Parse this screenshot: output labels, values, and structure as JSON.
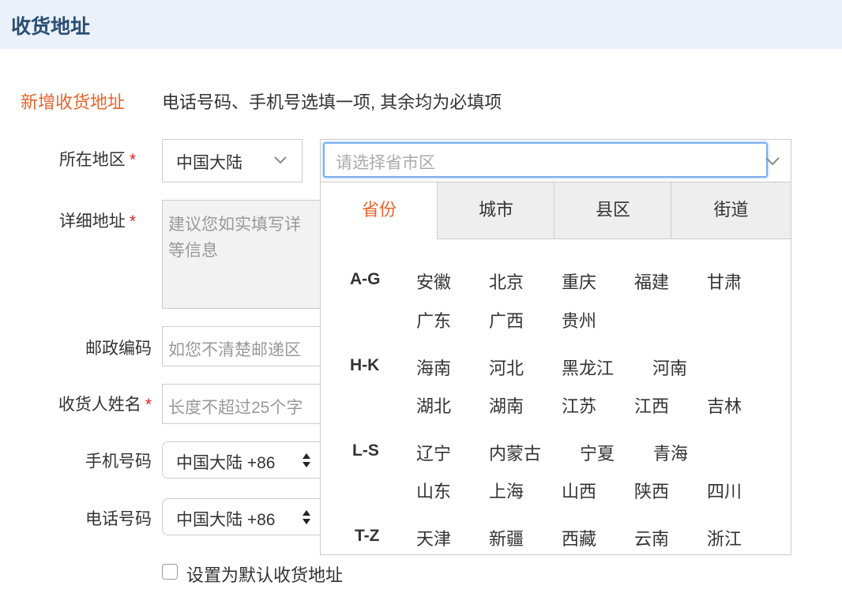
{
  "header": {
    "title": "收货地址"
  },
  "form": {
    "section_title": "新增收货地址",
    "section_hint": "电话号码、手机号选填一项, 其余均为必填项",
    "region": {
      "label": "所在地区",
      "country_value": "中国大陆",
      "placeholder": "请选择省市区"
    },
    "address": {
      "label": "详细地址",
      "placeholder": "建议您如实填写详\n等信息"
    },
    "postal": {
      "label": "邮政编码",
      "placeholder": "如您不清楚邮递区"
    },
    "recipient": {
      "label": "收货人姓名",
      "placeholder": "长度不超过25个字"
    },
    "mobile": {
      "label": "手机号码",
      "country_code": "中国大陆 +86"
    },
    "phone": {
      "label": "电话号码",
      "country_code": "中国大陆 +86"
    },
    "default_checkbox_label": "设置为默认收货地址"
  },
  "region_picker": {
    "tabs": [
      {
        "label": "省份",
        "active": true
      },
      {
        "label": "城市",
        "active": false
      },
      {
        "label": "县区",
        "active": false
      },
      {
        "label": "街道",
        "active": false
      }
    ],
    "groups": [
      {
        "label": "A-G",
        "rows": [
          [
            "安徽",
            "北京",
            "重庆",
            "福建",
            "甘肃"
          ],
          [
            "广东",
            "广西",
            "贵州"
          ]
        ]
      },
      {
        "label": "H-K",
        "rows": [
          [
            "海南",
            "河北",
            "黑龙江",
            "河南"
          ],
          [
            "湖北",
            "湖南",
            "江苏",
            "江西",
            "吉林"
          ]
        ]
      },
      {
        "label": "L-S",
        "rows": [
          [
            "辽宁",
            "内蒙古",
            "宁夏",
            "青海"
          ],
          [
            "山东",
            "上海",
            "山西",
            "陕西",
            "四川"
          ]
        ]
      },
      {
        "label": "T-Z",
        "rows": [
          [
            "天津",
            "新疆",
            "西藏",
            "云南",
            "浙江"
          ]
        ]
      }
    ]
  },
  "colors": {
    "accent": "#e5652c",
    "header_bg": "#eaf1fb",
    "header_text": "#2b4d73",
    "required": "#e02020",
    "focus": "#7aaef0"
  },
  "icons": {
    "select_arrow": "chevron-down-icon",
    "updown": "updown-arrows-icon"
  }
}
